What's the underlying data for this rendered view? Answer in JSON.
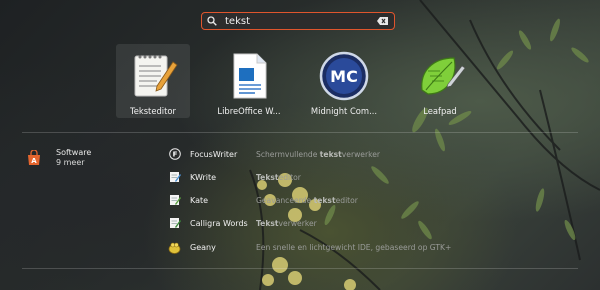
{
  "search": {
    "value": "tekst",
    "icon": "search-icon",
    "clear_icon": "clear-text-icon"
  },
  "apps": [
    {
      "label": "Teksteditor",
      "icon": "text-editor-icon",
      "selected": true
    },
    {
      "label": "LibreOffice W...",
      "icon": "libreoffice-writer-icon",
      "selected": false
    },
    {
      "label": "Midnight Com...",
      "icon": "midnight-commander-icon",
      "selected": false
    },
    {
      "label": "Leafpad",
      "icon": "leafpad-icon",
      "selected": false
    }
  ],
  "provider": {
    "name": "Software",
    "more": "9 meer",
    "icon": "software-center-icon"
  },
  "results": [
    {
      "name": "FocusWriter",
      "desc_pre": "Schermvullende ",
      "desc_bold": "tekst",
      "desc_post": "verwerker",
      "icon": "focuswriter-icon"
    },
    {
      "name": "KWrite",
      "desc_pre": "",
      "desc_bold": "Tekst",
      "desc_post": "editor",
      "icon": "kwrite-icon"
    },
    {
      "name": "Kate",
      "desc_pre": "Geavanceerde ",
      "desc_bold": "tekst",
      "desc_post": "editor",
      "icon": "kate-icon"
    },
    {
      "name": "Calligra Words",
      "desc_pre": "",
      "desc_bold": "Tekst",
      "desc_post": "verwerker",
      "icon": "calligra-words-icon"
    },
    {
      "name": "Geany",
      "desc_pre": "Een snelle en lichtgewicht IDE, gebaseerd op GTK+",
      "desc_bold": "",
      "desc_post": "",
      "icon": "geany-icon"
    }
  ],
  "colors": {
    "accent": "#e0552d",
    "software_orange": "#e4652e"
  }
}
